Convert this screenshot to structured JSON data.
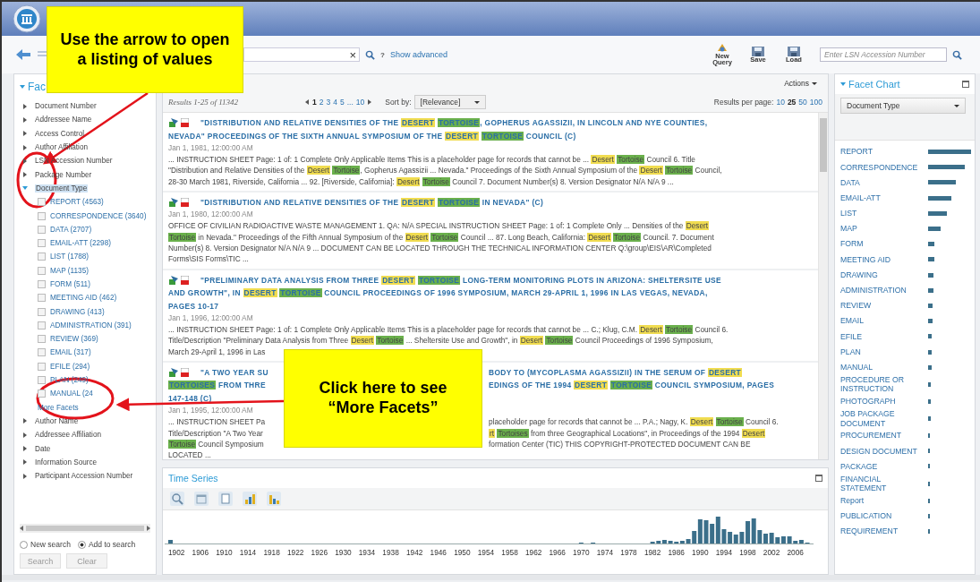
{
  "toolbar": {
    "search": {
      "clear": "×",
      "help": "?",
      "advanced_link": "Show advanced"
    },
    "buttons": [
      {
        "kind": "new",
        "label": "New Query"
      },
      {
        "kind": "save",
        "label": "Save"
      },
      {
        "kind": "load",
        "label": "Load"
      }
    ],
    "lsn_field": {
      "placeholder": "Enter LSN Accession Number"
    }
  },
  "facets": {
    "title": "Fac",
    "expanded": true,
    "items": [
      {
        "label": "Document Number",
        "expanded": false,
        "selected": false
      },
      {
        "label": "Addressee Name",
        "expanded": false,
        "selected": false
      },
      {
        "label": "Access Control",
        "expanded": false,
        "selected": false
      },
      {
        "label": "Author Affiliation",
        "expanded": false,
        "selected": false
      },
      {
        "label": "LSN Accession Number",
        "expanded": false,
        "selected": false
      },
      {
        "label": "Package Number",
        "expanded": false,
        "selected": false
      },
      {
        "label": "Document Type",
        "expanded": true,
        "selected": true,
        "more_link": "More Facets",
        "children": [
          {
            "label": "REPORT (4563)",
            "checked": false
          },
          {
            "label": "CORRESPONDENCE (3640)",
            "checked": false
          },
          {
            "label": "DATA (2707)",
            "checked": false
          },
          {
            "label": "EMAIL-ATT (2298)",
            "checked": false
          },
          {
            "label": "LIST (1788)",
            "checked": false
          },
          {
            "label": "MAP (1135)",
            "checked": false
          },
          {
            "label": "FORM (511)",
            "checked": false
          },
          {
            "label": "MEETING AID (462)",
            "checked": false
          },
          {
            "label": "DRAWING (413)",
            "checked": false
          },
          {
            "label": "ADMINISTRATION (391)",
            "checked": false
          },
          {
            "label": "REVIEW (369)",
            "checked": false
          },
          {
            "label": "EMAIL (317)",
            "checked": false
          },
          {
            "label": "EFILE (294)",
            "checked": false
          },
          {
            "label": "PLAN (249)",
            "checked": false
          },
          {
            "label": "MANUAL (24",
            "checked": false
          }
        ]
      },
      {
        "label": "Author Name",
        "expanded": false,
        "selected": false
      },
      {
        "label": "Addressee Affiliation",
        "expanded": false,
        "selected": false
      },
      {
        "label": "Date",
        "expanded": false,
        "selected": false
      },
      {
        "label": "Information Source",
        "expanded": false,
        "selected": false
      },
      {
        "label": "Participant Accession Number",
        "expanded": false,
        "selected": false
      }
    ],
    "modes": [
      {
        "label": "New search",
        "selected": false
      },
      {
        "label": "Add to search",
        "selected": true
      }
    ],
    "buttons": [
      "Search",
      "Clear"
    ]
  },
  "results": {
    "actions": "Actions",
    "count": "Results 1-25 of 11342",
    "pages": [
      {
        "label": "1",
        "selected": true
      },
      {
        "label": "2",
        "selected": false
      },
      {
        "label": "3",
        "selected": false
      },
      {
        "label": "4",
        "selected": false
      },
      {
        "label": "5",
        "selected": false
      },
      {
        "label": "...",
        "selected": false
      },
      {
        "label": "10",
        "selected": false
      }
    ],
    "sort_label": "Sort by:",
    "sort_value": "[Relevance]",
    "per_page_label": "Results per page:",
    "per_page": [
      {
        "label": "10",
        "selected": false
      },
      {
        "label": "25",
        "selected": true
      },
      {
        "label": "50",
        "selected": false
      },
      {
        "label": "100",
        "selected": false
      }
    ],
    "items": [
      {
        "title": [
          [
            "\"DISTRIBUTION AND RELATIVE DENSITIES OF THE ",
            {
              "t": "DESERT",
              "color": "#f0dc50"
            },
            {
              "t": "TORTOISE",
              "color": "#6ab04c"
            },
            ", GOPHERUS AGASSIZII, IN LINCOLN AND NYE COUNTIES,"
          ],
          [
            "NEVADA\" PROCEEDINGS OF THE SIXTH ANNUAL SYMPOSIUM OF THE ",
            {
              "t": "DESERT",
              "color": "#f0dc50"
            },
            {
              "t": "TORTOISE",
              "color": "#6ab04c"
            },
            " COUNCIL (C)"
          ]
        ],
        "date": "Jan 1, 1981, 12:00:00 AM",
        "snippet": [
          [
            "... INSTRUCTION SHEET Page: 1 of: 1 Complete Only Applicable Items This is a placeholder page for records that cannot be ... ",
            {
              "t": "Desert",
              "color": "#f0dc50"
            },
            {
              "t": "Tortoise",
              "color": "#6ab04c"
            },
            " Council 6. Title"
          ],
          [
            "\"Distribution and Relative Densities of the ",
            {
              "t": "Desert",
              "color": "#f0dc50"
            },
            {
              "t": "Tortoise",
              "color": "#6ab04c"
            },
            ", Gopherus Agassizii ... Nevada.\" Proceedings of the Sixth Annual Symposium of the ",
            {
              "t": "Desert",
              "color": "#f0dc50"
            },
            {
              "t": "Tortoise",
              "color": "#6ab04c"
            },
            " Council,"
          ],
          [
            "28-30 March 1981, Riverside, California ... 92. [Riverside, California]: ",
            {
              "t": "Desert",
              "color": "#f0dc50"
            },
            {
              "t": "Tortoise",
              "color": "#6ab04c"
            },
            " Council 7. Document Number(s) 8. Version Designator N/A N/A 9 ..."
          ]
        ]
      },
      {
        "title": [
          [
            "\"DISTRIBUTION AND RELATIVE DENSITIES OF THE ",
            {
              "t": "DESERT",
              "color": "#f0dc50"
            },
            {
              "t": "TORTOISE",
              "color": "#6ab04c"
            },
            " IN NEVADA\" (C)"
          ]
        ],
        "date": "Jan 1, 1980, 12:00:00 AM",
        "snippet": [
          [
            "OFFICE OF CIVILIAN RADIOACTIVE WASTE MANAGEMENT 1. QA: N/A SPECIAL INSTRUCTION SHEET Page: 1 of: 1 Complete Only ... Densities of the ",
            {
              "t": "Desert",
              "color": "#f0dc50"
            }
          ],
          [
            {
              "t": "Tortoise",
              "color": "#6ab04c"
            },
            " in Nevada.\" Proceedings of the Fifth Annual Symposium of the ",
            {
              "t": "Desert",
              "color": "#f0dc50"
            },
            {
              "t": "Tortoise",
              "color": "#6ab04c"
            },
            " Council ... 87. Long Beach, California: ",
            {
              "t": "Desert",
              "color": "#f0dc50"
            },
            {
              "t": "Tortoise",
              "color": "#6ab04c"
            },
            " Council. 7. Document"
          ],
          [
            "Number(s) 8. Version Designator N/A N/A 9 ... DOCUMENT CAN BE LOCATED THROUGH THE TECHNICAL INFORMATION CENTER Q:\\group\\EIS\\AR\\Completed"
          ],
          [
            "Forms\\SIS Forms\\TIC ..."
          ]
        ]
      },
      {
        "title": [
          [
            "\"PRELIMINARY DATA ANALYSIS FROM THREE ",
            {
              "t": "DESERT",
              "color": "#f0dc50"
            },
            {
              "t": "TORTOISE",
              "color": "#6ab04c"
            },
            " LONG-TERM MONITORING PLOTS IN ARIZONA: SHELTERSITE USE"
          ],
          [
            "AND GROWTH\", IN ",
            {
              "t": "DESERT",
              "color": "#f0dc50"
            },
            {
              "t": "TORTOISE",
              "color": "#6ab04c"
            },
            " COUNCIL PROCEEDINGS OF 1996 SYMPOSIUM, MARCH 29-APRIL 1, 1996 IN LAS VEGAS, NEVADA,"
          ],
          [
            "PAGES 10-17"
          ]
        ],
        "date": "Jan 1, 1996, 12:00:00 AM",
        "snippet": [
          [
            "... INSTRUCTION SHEET Page: 1 of: 1 Complete Only Applicable Items This is a placeholder page for records that cannot be ... C.; Klug, C.M. ",
            {
              "t": "Desert",
              "color": "#f0dc50"
            },
            {
              "t": "Tortoise",
              "color": "#6ab04c"
            },
            " Council 6."
          ],
          [
            "Title/Description \"Preliminary Data Analysis from Three ",
            {
              "t": "Desert",
              "color": "#f0dc50"
            },
            {
              "t": "Tortoise",
              "color": "#6ab04c"
            },
            " ... Sheltersite Use and Growth\", in ",
            {
              "t": "Desert",
              "color": "#f0dc50"
            },
            {
              "t": "Tortoise",
              "color": "#6ab04c"
            },
            " Council Proceedings of 1996 Symposium,"
          ],
          [
            "March 29-April 1, 1996 in Las"
          ]
        ]
      },
      {
        "title": [
          {
            "left": [
              "\"A TWO YEAR SU"
            ],
            "right": [
              "BODY TO (MYCOPLASMA AGASSIZII) IN THE SERUM OF ",
              {
                "t": "DESERT",
                "color": "#f0dc50"
              }
            ]
          },
          {
            "left": [
              {
                "t": "TORTOISES",
                "color": "#6ab04c"
              },
              " FROM THRE"
            ],
            "right": [
              "EDINGS OF THE 1994 ",
              {
                "t": "DESERT",
                "color": "#f0dc50"
              },
              {
                "t": "TORTOISE",
                "color": "#6ab04c"
              },
              " COUNCIL SYMPOSIUM, PAGES"
            ]
          },
          [
            "147-148 (C)"
          ]
        ],
        "date": "Jan 1, 1995, 12:00:00 AM",
        "snippet": [
          {
            "left": [
              "... INSTRUCTION SHEET Pa"
            ],
            "right": [
              "placeholder page for records that cannot be ... P.A.; Nagy, K. ",
              {
                "t": "Desert",
                "color": "#f0dc50"
              },
              {
                "t": "Tortoise",
                "color": "#6ab04c"
              },
              " Council 6."
            ]
          },
          {
            "left": [
              "Title/Description \"A Two Year"
            ],
            "right": [
              {
                "t": "rt",
                "color": "#f0dc50"
              },
              {
                "t": "Tortoises",
                "color": "#6ab04c"
              },
              " from three Geographical Locations\", in Proceedings of the 1994 ",
              {
                "t": "Desert",
                "color": "#f0dc50"
              }
            ]
          },
          {
            "left": [
              {
                "t": "Tortoise",
                "color": "#6ab04c"
              },
              " Council Symposium"
            ],
            "right": [
              "formation Center (TIC) THIS COPYRIGHT-PROTECTED DOCUMENT CAN BE"
            ]
          },
          [
            "LOCATED ..."
          ]
        ]
      }
    ]
  },
  "time_series": {
    "title": "Time Series",
    "years": [
      "1902",
      "1906",
      "1910",
      "1914",
      "1918",
      "1922",
      "1926",
      "1930",
      "1934",
      "1938",
      "1942",
      "1946",
      "1950",
      "1954",
      "1958",
      "1962",
      "1966",
      "1970",
      "1974",
      "1978",
      "1982",
      "1986",
      "1990",
      "1994",
      "1998",
      "2002",
      "2006"
    ]
  },
  "facet_chart": {
    "title": "Facet Chart",
    "dropdown": "Document Type",
    "labels": [
      "REPORT",
      "CORRESPONDENCE",
      "DATA",
      "EMAIL-ATT",
      "LIST",
      "MAP",
      "FORM",
      "MEETING AID",
      "DRAWING",
      "ADMINISTRATION",
      "REVIEW",
      "EMAIL",
      "EFILE",
      "PLAN",
      "MANUAL",
      "PROCEDURE OR INSTRUCTION",
      "PHOTOGRAPH",
      "JOB PACKAGE DOCUMENT",
      "PROCUREMENT",
      "DESIGN DOCUMENT",
      "PACKAGE",
      "FINANCIAL STATEMENT",
      "Report",
      "PUBLICATION",
      "REQUIREMENT"
    ]
  },
  "callouts": [
    {
      "kind": "top",
      "text": "Use the arrow to open a listing of values"
    },
    {
      "kind": "middle",
      "text": "Click here to see “More Facets”"
    }
  ]
}
